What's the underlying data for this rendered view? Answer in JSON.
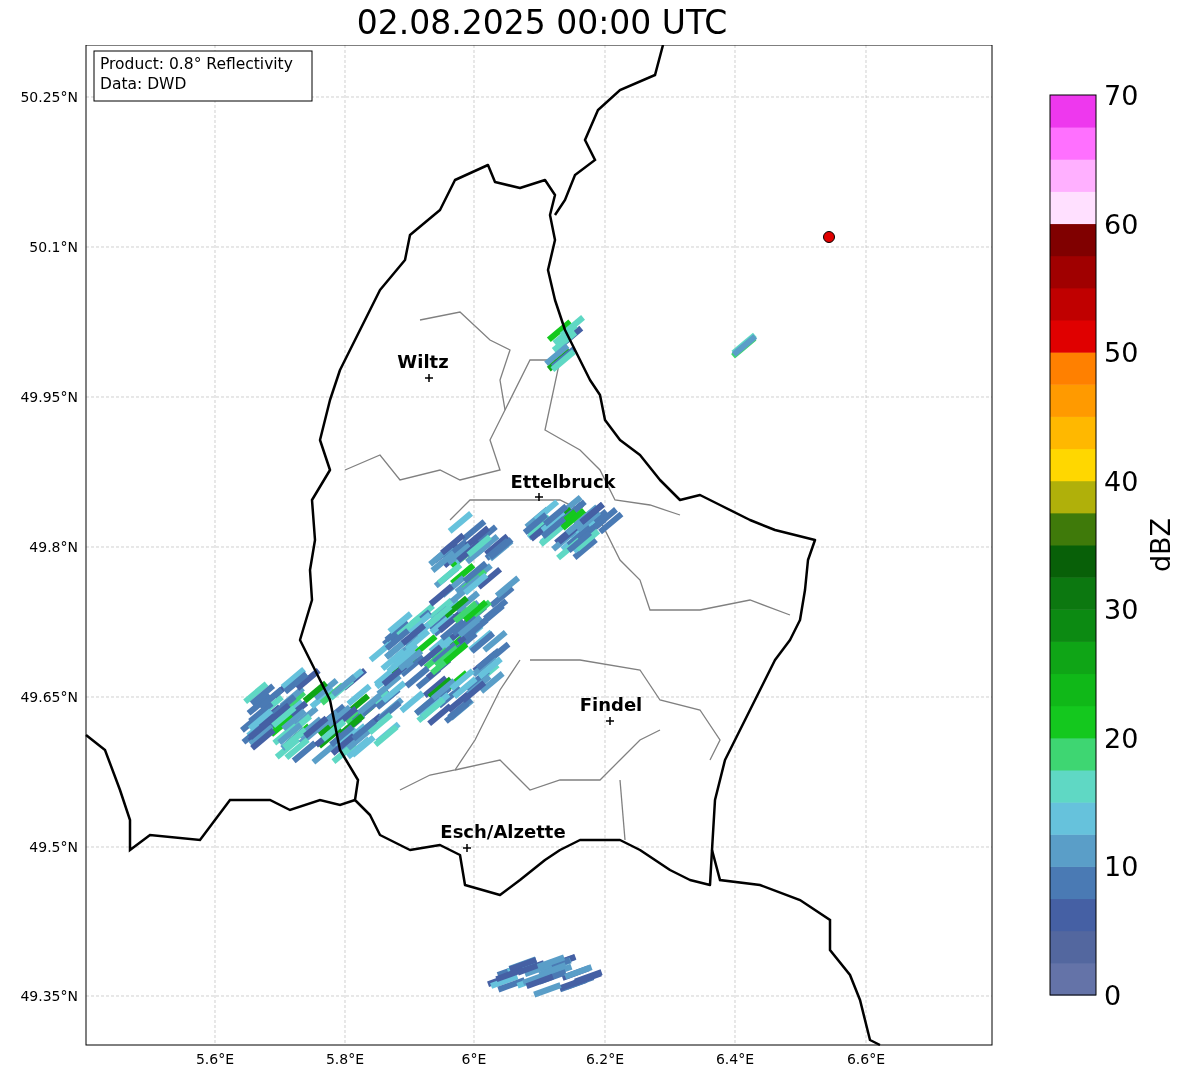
{
  "title": "02.08.2025 00:00 UTC",
  "info_box": [
    "Product: 0.8° Reflectivity",
    "Data: DWD"
  ],
  "y_ticks": [
    "50.25°N",
    "50.1°N",
    "49.95°N",
    "49.8°N",
    "49.65°N",
    "49.5°N",
    "49.35°N"
  ],
  "x_ticks": [
    "5.6°E",
    "5.8°E",
    "6°E",
    "6.2°E",
    "6.4°E",
    "6.6°E"
  ],
  "cities": [
    {
      "name": "Wiltz"
    },
    {
      "name": "Ettelbruck"
    },
    {
      "name": "Findel"
    },
    {
      "name": "Esch/Alzette"
    }
  ],
  "colorbar": {
    "label": "dBZ",
    "ticks": [
      "70",
      "60",
      "50",
      "40",
      "30",
      "20",
      "10",
      "0"
    ],
    "bins": [
      {
        "color": "#6473a8"
      },
      {
        "color": "#53679f"
      },
      {
        "color": "#4560a4"
      },
      {
        "color": "#4a7ab4"
      },
      {
        "color": "#5a9ec8"
      },
      {
        "color": "#66c2dc"
      },
      {
        "color": "#5fd8c4"
      },
      {
        "color": "#3ed672"
      },
      {
        "color": "#14c81e"
      },
      {
        "color": "#10b818"
      },
      {
        "color": "#0fa516"
      },
      {
        "color": "#0c8a12"
      },
      {
        "color": "#0c7810"
      },
      {
        "color": "#086008"
      },
      {
        "color": "#3f7a0a"
      },
      {
        "color": "#b0b00a"
      },
      {
        "color": "#ffd700"
      },
      {
        "color": "#ffb800"
      },
      {
        "color": "#ff9a00"
      },
      {
        "color": "#ff8000"
      },
      {
        "color": "#e00000"
      },
      {
        "color": "#c00000"
      },
      {
        "color": "#a00000"
      },
      {
        "color": "#800000"
      },
      {
        "color": "#ffe0ff"
      },
      {
        "color": "#ffb0ff"
      },
      {
        "color": "#ff70ff"
      },
      {
        "color": "#ee38ee"
      }
    ]
  }
}
